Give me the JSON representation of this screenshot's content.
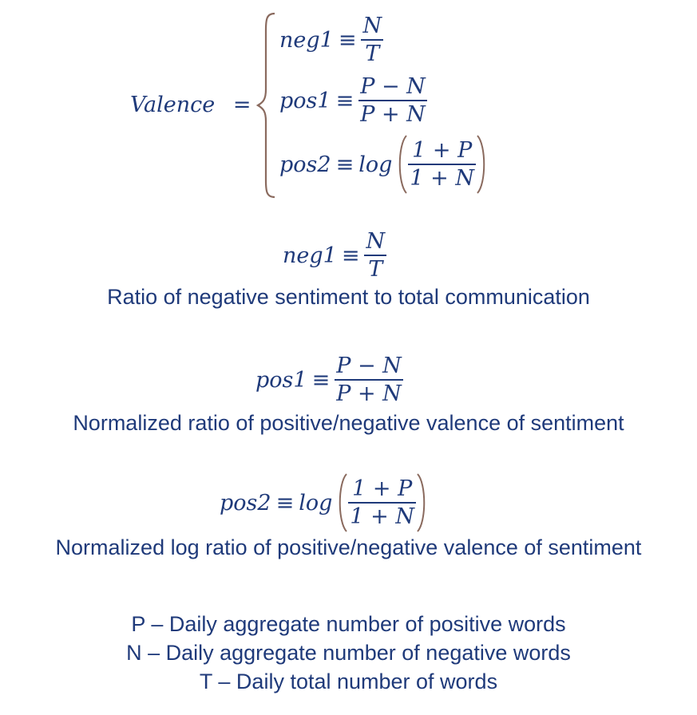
{
  "system": {
    "lhs": "Valence",
    "eq": "=",
    "cases": [
      {
        "name": "neg1",
        "op": "≡",
        "num": "N",
        "den": "T"
      },
      {
        "name": "pos1",
        "op": "≡",
        "num": "P − N",
        "den": "P + N"
      },
      {
        "name": "pos2",
        "op": "≡",
        "fn": "log",
        "num": "1 + P",
        "den": "1 + N"
      }
    ]
  },
  "definitions": [
    {
      "name": "neg1",
      "op": "≡",
      "num": "N",
      "den": "T",
      "description": "Ratio of negative sentiment to total communication"
    },
    {
      "name": "pos1",
      "op": "≡",
      "num": "P − N",
      "den": "P + N",
      "description": "Normalized ratio of positive/negative valence of sentiment"
    },
    {
      "name": "pos2",
      "op": "≡",
      "fn": "log",
      "num": "1 + P",
      "den": "1 + N",
      "description": "Normalized log ratio of positive/negative valence of sentiment"
    }
  ],
  "legend": [
    "P – Daily aggregate number of positive words",
    "N – Daily aggregate number of negative words",
    "T – Daily total number of words"
  ],
  "colors": {
    "text": "#1f3a7a",
    "brace": "#8a6a5e"
  }
}
